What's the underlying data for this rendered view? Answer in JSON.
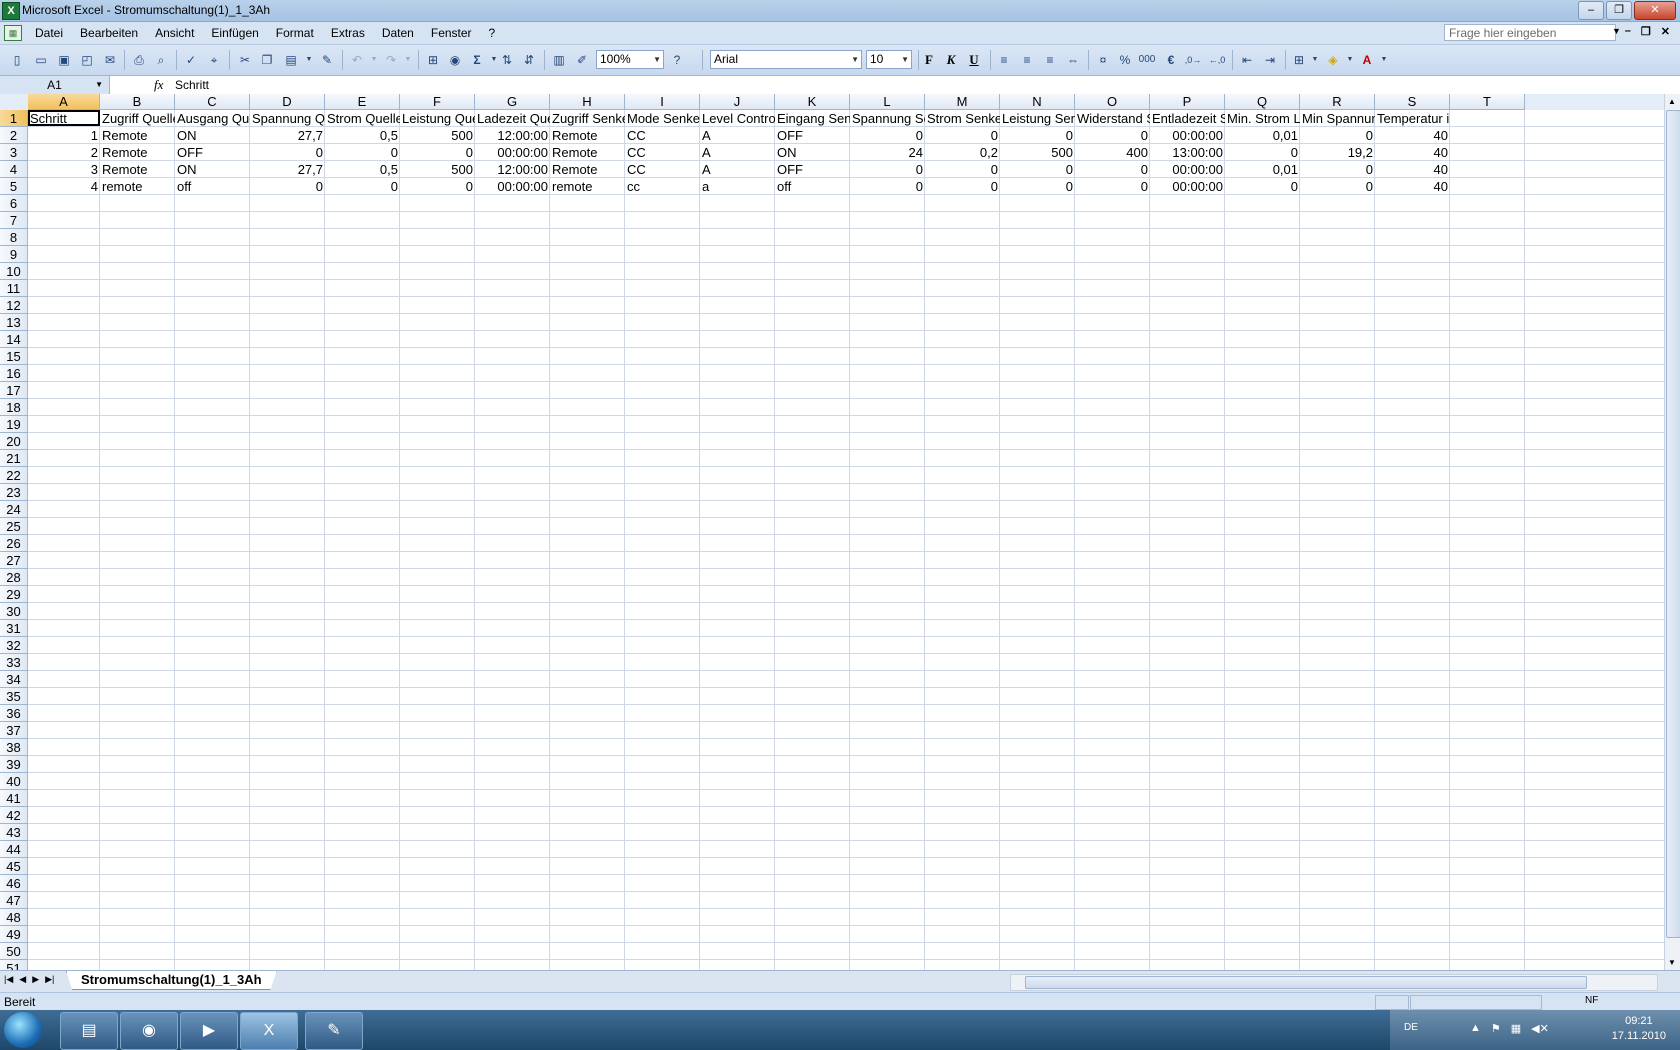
{
  "window": {
    "title": "Microsoft Excel - Stromumschaltung(1)_1_3Ah",
    "app_icon": "excel-icon"
  },
  "menu": {
    "items": [
      "Datei",
      "Bearbeiten",
      "Ansicht",
      "Einfügen",
      "Format",
      "Extras",
      "Daten",
      "Fenster",
      "?"
    ],
    "help_placeholder": "Frage hier eingeben"
  },
  "toolbar": {
    "zoom": "100%",
    "font_name": "Arial",
    "font_size": "10",
    "bold": "F",
    "italic": "K",
    "underline": "U",
    "percent": "%",
    "thousands": "000",
    "euro": "€",
    "sum": "Σ"
  },
  "formula_bar": {
    "name_box": "A1",
    "fx": "fx",
    "content": "Schritt"
  },
  "sheet": {
    "columns": [
      "A",
      "B",
      "C",
      "D",
      "E",
      "F",
      "G",
      "H",
      "I",
      "J",
      "K",
      "L",
      "M",
      "N",
      "O",
      "P",
      "Q",
      "R",
      "S",
      "T"
    ],
    "selected_column": "A",
    "selected_row": 1,
    "visible_rows": 51,
    "headers": [
      "Schritt",
      "Zugriff Quelle",
      "Ausgang Que",
      "Spannung Qu",
      "Strom Quelle",
      "Leistung Que",
      "Ladezeit Que",
      "Zugriff Senke",
      "Mode Senke",
      "Level Control",
      "Eingang Senl",
      "Spannung Se",
      "Strom Senke",
      "Leistung Sen",
      "Widerstand S",
      "Entladezeit S",
      "Min. Strom L",
      "Min Spannun",
      "Temperatur in °C"
    ],
    "rows": [
      [
        "1",
        "Remote",
        "ON",
        "27,7",
        "0,5",
        "500",
        "12:00:00",
        "Remote",
        "CC",
        "A",
        "OFF",
        "0",
        "0",
        "0",
        "0",
        "00:00:00",
        "0,01",
        "0",
        "40"
      ],
      [
        "2",
        "Remote",
        "OFF",
        "0",
        "0",
        "0",
        "00:00:00",
        "Remote",
        "CC",
        "A",
        "ON",
        "24",
        "0,2",
        "500",
        "400",
        "13:00:00",
        "0",
        "19,2",
        "40"
      ],
      [
        "3",
        "Remote",
        "ON",
        "27,7",
        "0,5",
        "500",
        "12:00:00",
        "Remote",
        "CC",
        "A",
        "OFF",
        "0",
        "0",
        "0",
        "0",
        "00:00:00",
        "0,01",
        "0",
        "40"
      ],
      [
        "4",
        "remote",
        "off",
        "0",
        "0",
        "0",
        "00:00:00",
        "remote",
        "cc",
        "a",
        "off",
        "0",
        "0",
        "0",
        "0",
        "00:00:00",
        "0",
        "0",
        "40"
      ]
    ],
    "numeric_columns": [
      0,
      3,
      4,
      5,
      6,
      11,
      12,
      13,
      14,
      15,
      16,
      17,
      18
    ]
  },
  "sheet_tab": "Stromumschaltung(1)_1_3Ah",
  "status": {
    "text": "Bereit",
    "nf": "NF"
  },
  "taskbar": {
    "items": [
      "explorer-icon",
      "firefox-icon",
      "media-icon",
      "excel-icon",
      "paint-icon"
    ],
    "tray_lang": "DE",
    "time": "09:21",
    "date": "17.11.2010"
  }
}
